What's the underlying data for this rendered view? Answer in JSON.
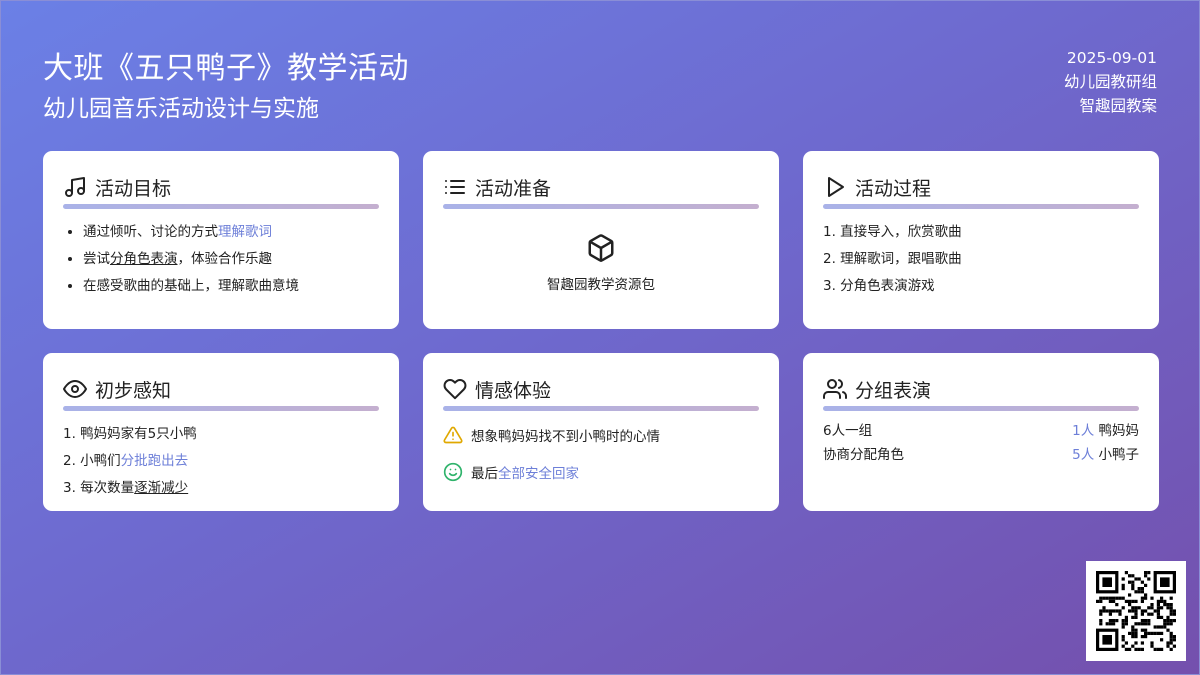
{
  "header": {
    "title": "大班《五只鸭子》教学活动",
    "subtitle": "幼儿园音乐活动设计与实施",
    "date": "2025-09-01",
    "org": "幼儿园教研组",
    "brand": "智趣园教案"
  },
  "cards": {
    "goals": {
      "title": "活动目标",
      "icon": "music-note-icon",
      "items": [
        {
          "pre": "通过倾听、讨论的方式",
          "hl": "理解歌词",
          "ul": "",
          "post": ""
        },
        {
          "pre": "尝试",
          "hl": "",
          "ul": "分角色表演",
          "post": "，体验合作乐趣"
        },
        {
          "pre": "在感受歌曲的基础上，理解歌曲意境",
          "hl": "",
          "ul": "",
          "post": ""
        }
      ]
    },
    "prep": {
      "title": "活动准备",
      "icon": "list-icon",
      "item_icon": "package-icon",
      "item_label": "智趣园教学资源包"
    },
    "process": {
      "title": "活动过程",
      "icon": "play-icon",
      "items": [
        "1. 直接导入，欣赏歌曲",
        "2. 理解歌词，跟唱歌曲",
        "3. 分角色表演游戏"
      ]
    },
    "perception": {
      "title": "初步感知",
      "icon": "eye-icon",
      "items": [
        {
          "pre": "1. 鸭妈妈家有5只小鸭",
          "hl": "",
          "ul": ""
        },
        {
          "pre": "2. 小鸭们",
          "hl": "分批跑出去",
          "ul": ""
        },
        {
          "pre": "3. 每次数量",
          "hl": "",
          "ul": "逐渐减少"
        }
      ]
    },
    "emotion": {
      "title": "情感体验",
      "icon": "heart-icon",
      "rows": [
        {
          "icon": "warning-icon",
          "pre": "想象鸭妈妈找不到小鸭时的心情",
          "hl": ""
        },
        {
          "icon": "smile-icon",
          "pre": "最后",
          "hl": "全部安全回家"
        }
      ]
    },
    "group": {
      "title": "分组表演",
      "icon": "users-icon",
      "rows": [
        {
          "left": "6人一组",
          "count": "1人",
          "role": "鸭妈妈"
        },
        {
          "left": "协商分配角色",
          "count": "5人",
          "role": "小鸭子"
        }
      ]
    }
  },
  "colors": {
    "accent": "#6d7fd8",
    "bg_start": "#6b80e6",
    "bg_end": "#7450ad",
    "warning": "#e0a800",
    "success": "#2fb36b"
  }
}
